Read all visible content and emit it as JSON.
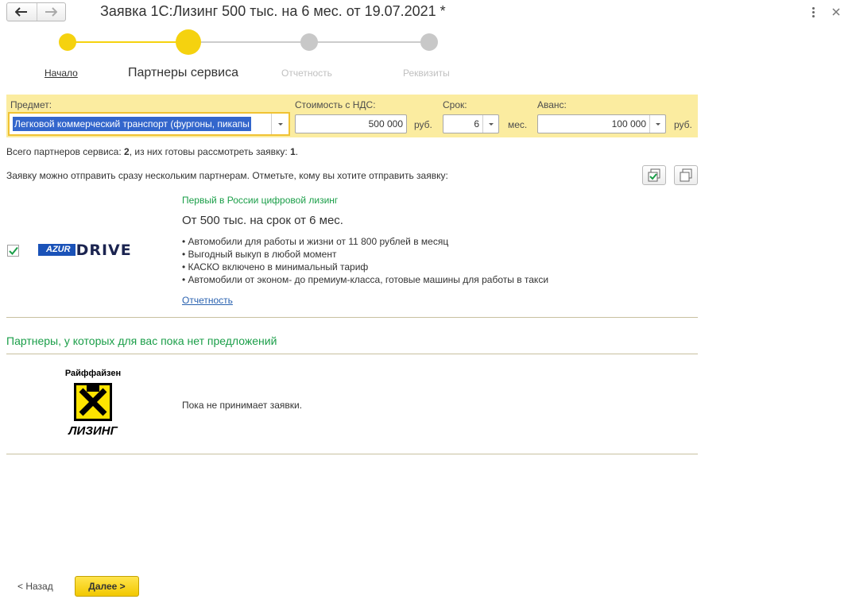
{
  "window": {
    "title": "Заявка 1С:Лизинг 500 тыс. на 6 мес. от 19.07.2021 *"
  },
  "steps": [
    {
      "label": "Начало",
      "state": "done"
    },
    {
      "label": "Партнеры сервиса",
      "state": "current"
    },
    {
      "label": "Отчетность",
      "state": "todo"
    },
    {
      "label": "Реквизиты",
      "state": "todo"
    }
  ],
  "params": {
    "subject_label": "Предмет:",
    "subject_value": "Легковой коммерческий транспорт (фургоны, пикапы",
    "cost_label": "Стоимость с НДС:",
    "cost_value": "500 000",
    "cost_unit": "руб.",
    "term_label": "Срок:",
    "term_value": "6",
    "term_unit": "мес.",
    "advance_label": "Аванс:",
    "advance_value": "100 000",
    "advance_unit": "руб."
  },
  "summary": {
    "prefix": "Всего партнеров сервиса: ",
    "total": "2",
    "middle": ", из них готовы рассмотреть заявку: ",
    "ready": "1",
    "suffix": "."
  },
  "instruction": "Заявку можно отправить сразу нескольким партнерам. Отметьте, кому вы хотите отправить заявку:",
  "partner_offer": {
    "logo_text_a": "AZUR",
    "logo_text_b": "DRIVE",
    "checked": true,
    "tagline": "Первый в России цифровой лизинг",
    "headline": "От 500 тыс. на срок от 6 мес.",
    "bullets": [
      "Автомобили для работы и жизни от 11 800 рублей в месяц",
      "Выгодный выкуп в любой момент",
      "КАСКО включено в минимальный тариф",
      "Автомобили от эконом- до премиум-класса, готовые машины для работы в такси"
    ],
    "link": "Отчетность"
  },
  "no_offers": {
    "title": "Партнеры, у которых для вас пока нет предложений",
    "logo_top": "Райффайзен",
    "logo_bottom": "ЛИЗИНГ",
    "status": "Пока не принимает заявки."
  },
  "footer": {
    "back_label": "< Назад",
    "next_label": "Далее >"
  },
  "colors": {
    "accent_yellow": "#f5d20f",
    "panel_yellow": "#fbeca0",
    "green_text": "#1a9e48",
    "link_blue": "#2a62b0"
  }
}
